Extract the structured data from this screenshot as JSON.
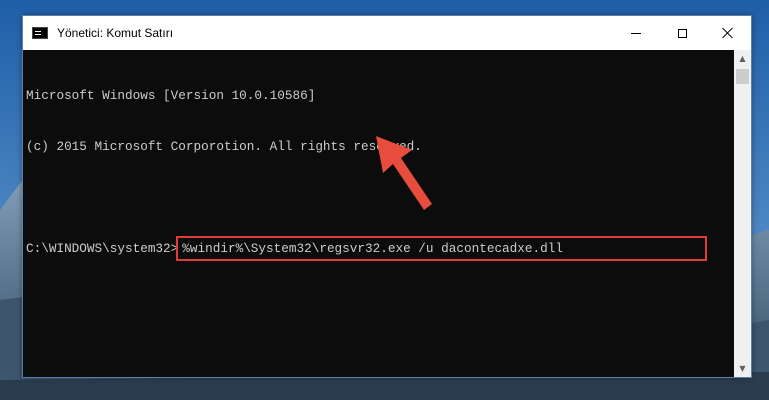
{
  "window": {
    "title": "Yönetici: Komut Satırı",
    "icon": "cmd-icon"
  },
  "console": {
    "lines": [
      "Microsoft Windows [Version 10.0.10586]",
      "(c) 2015 Microsoft Corporotion. All rights reserved.",
      ""
    ],
    "prompt": "C:\\WINDOWS\\system32>",
    "command": "%windir%\\System32\\regsvr32.exe /u dacontecadxe.dll"
  },
  "scrollbar": {
    "up_glyph": "▲",
    "down_glyph": "▼"
  },
  "colors": {
    "console_bg": "#0c0c0c",
    "console_text": "#cccccc",
    "highlight": "#e23b3b",
    "arrow": "#e74c3c"
  }
}
